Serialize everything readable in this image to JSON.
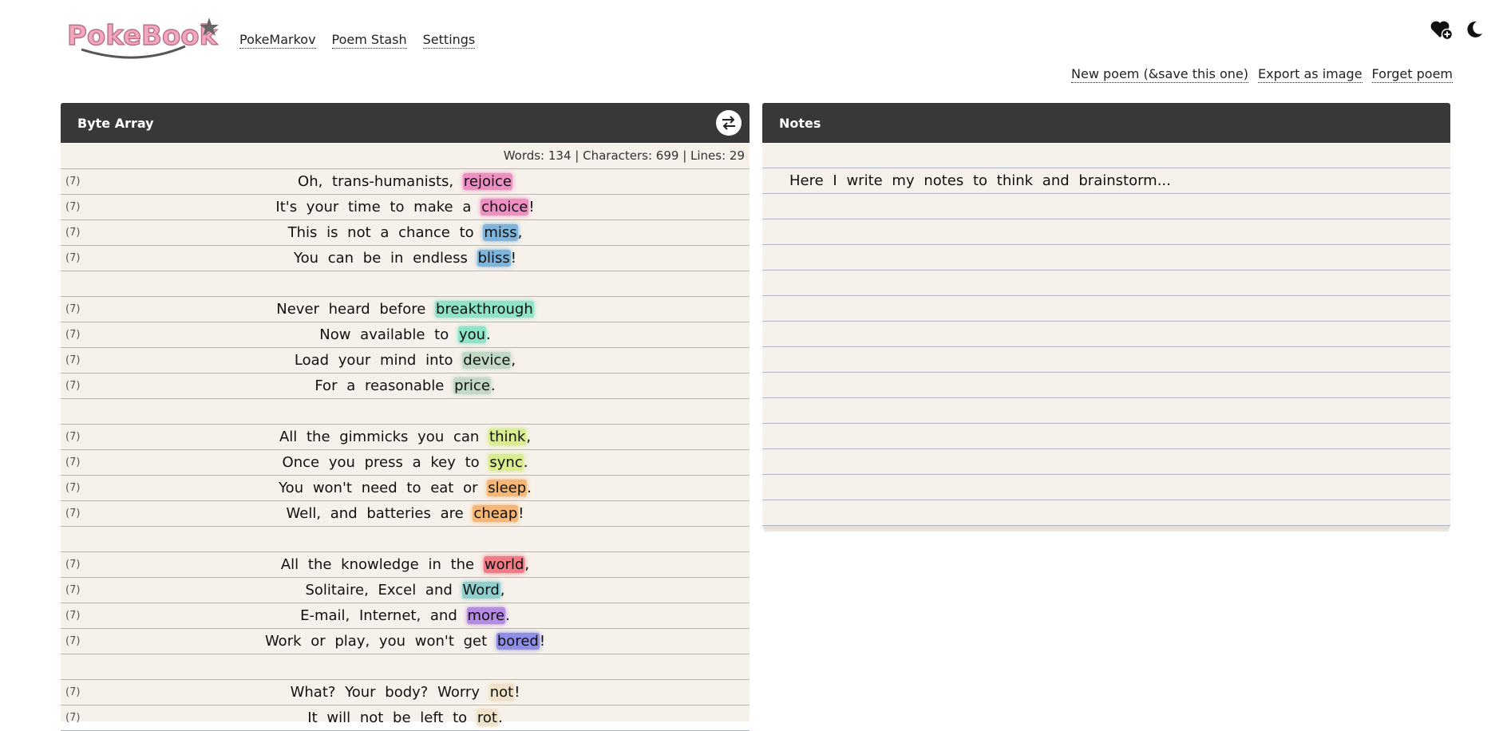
{
  "app": {
    "logo_text": "PokeBook"
  },
  "nav": {
    "items": [
      {
        "label": "PokeMarkov"
      },
      {
        "label": "Poem Stash"
      },
      {
        "label": "Settings"
      }
    ]
  },
  "icons": {
    "favorite": "heart-plus-icon",
    "theme": "moon-icon",
    "swap": "swap-icon"
  },
  "actions": {
    "new_poem": "New poem (&save this one)",
    "export": "Export as image",
    "forget": "Forget poem"
  },
  "poem_panel": {
    "title": "Byte Array",
    "stats": "Words: 134 | Characters: 699 | Lines: 29",
    "lines": [
      {
        "syl": "(7)",
        "text": "Oh, trans-humanists,",
        "rhyme": "rejoice",
        "punct": "",
        "color": "#ee8fc3"
      },
      {
        "syl": "(7)",
        "text": "It's your time to make a",
        "rhyme": "choice",
        "punct": "!",
        "color": "#ee8fc3"
      },
      {
        "syl": "(7)",
        "text": "This is not a chance to",
        "rhyme": "miss",
        "punct": ",",
        "color": "#7db5dd"
      },
      {
        "syl": "(7)",
        "text": "You can be in endless",
        "rhyme": "bliss",
        "punct": "!",
        "color": "#7db5dd"
      },
      {
        "syl": "",
        "text": "",
        "rhyme": "",
        "punct": "",
        "color": ""
      },
      {
        "syl": "(7)",
        "text": "Never heard before",
        "rhyme": "breakthrough",
        "punct": "",
        "color": "#8ee3c8"
      },
      {
        "syl": "(7)",
        "text": "Now available to",
        "rhyme": "you",
        "punct": ".",
        "color": "#8ee3c8"
      },
      {
        "syl": "(7)",
        "text": "Load your mind into",
        "rhyme": "device",
        "punct": ",",
        "color": "#c2d8c6"
      },
      {
        "syl": "(7)",
        "text": "For a reasonable",
        "rhyme": "price",
        "punct": ".",
        "color": "#c2d8c6"
      },
      {
        "syl": "",
        "text": "",
        "rhyme": "",
        "punct": "",
        "color": ""
      },
      {
        "syl": "(7)",
        "text": "All the gimmicks you can",
        "rhyme": "think",
        "punct": ",",
        "color": "#d9ec8e"
      },
      {
        "syl": "(7)",
        "text": "Once you press a key to",
        "rhyme": "sync",
        "punct": ".",
        "color": "#d9ec8e"
      },
      {
        "syl": "(7)",
        "text": "You won't need to eat or",
        "rhyme": "sleep",
        "punct": ".",
        "color": "#f5b773"
      },
      {
        "syl": "(7)",
        "text": "Well, and batteries are",
        "rhyme": "cheap",
        "punct": "!",
        "color": "#f5b773"
      },
      {
        "syl": "",
        "text": "",
        "rhyme": "",
        "punct": "",
        "color": ""
      },
      {
        "syl": "(7)",
        "text": "All the knowledge in the",
        "rhyme": "world",
        "punct": ",",
        "color": "#f07b86"
      },
      {
        "syl": "(7)",
        "text": "Solitaire, Excel and",
        "rhyme": "Word",
        "punct": ",",
        "color": "#8fcfcf"
      },
      {
        "syl": "(7)",
        "text": "E-mail, Internet, and",
        "rhyme": "more",
        "punct": ".",
        "color": "#b48ae6"
      },
      {
        "syl": "(7)",
        "text": "Work or play, you won't get",
        "rhyme": "bored",
        "punct": "!",
        "color": "#8f8fe8"
      },
      {
        "syl": "",
        "text": "",
        "rhyme": "",
        "punct": "",
        "color": ""
      },
      {
        "syl": "(7)",
        "text": "What? Your body? Worry",
        "rhyme": "not",
        "punct": "!",
        "color": "#efe2c8"
      },
      {
        "syl": "(7)",
        "text": "It will not be left to",
        "rhyme": "rot",
        "punct": ".",
        "color": "#efe2c8"
      }
    ]
  },
  "notes_panel": {
    "title": "Notes",
    "text": "Here I write my notes to think and brainstorm..."
  }
}
